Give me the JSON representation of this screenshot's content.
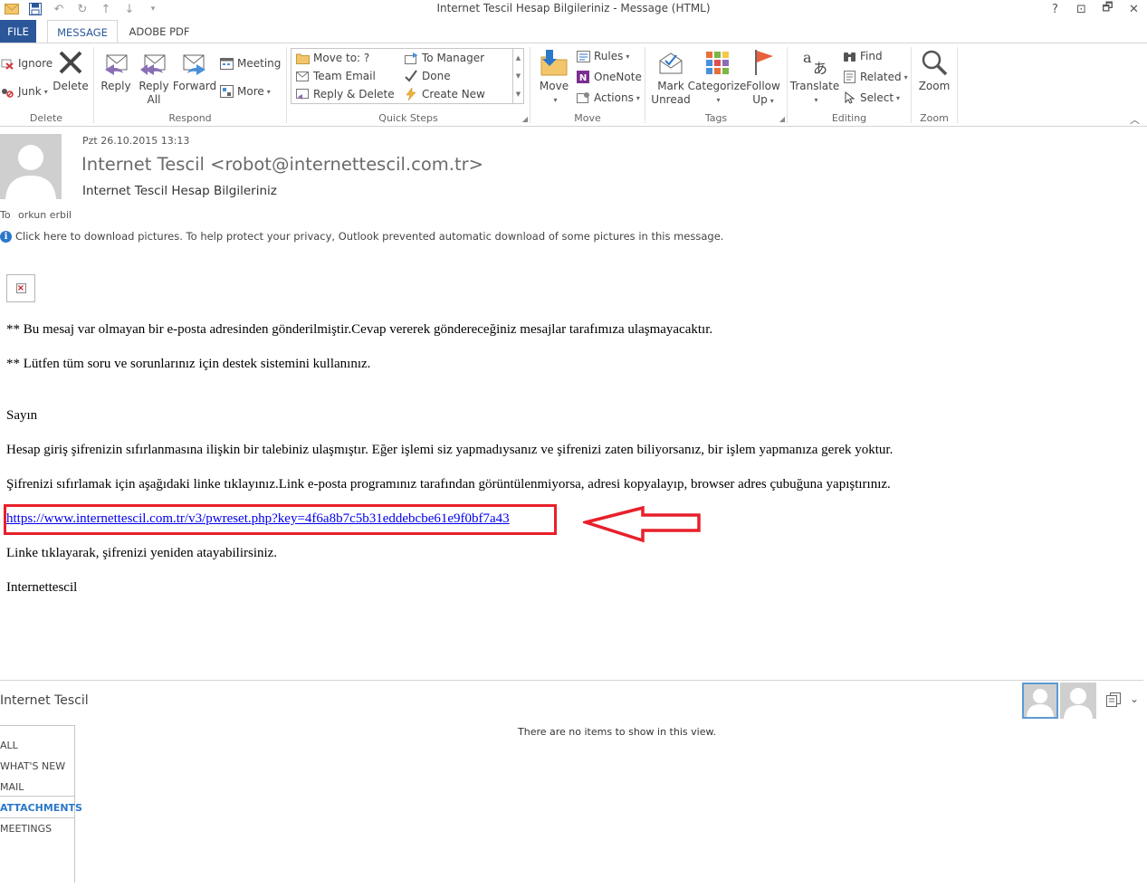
{
  "window": {
    "title": "Internet Tescil Hesap Bilgileriniz - Message (HTML)",
    "qat_icons": [
      "mail-icon",
      "save-icon",
      "undo-icon",
      "redo-icon",
      "up-icon",
      "down-icon",
      "customize-icon"
    ],
    "buttons": [
      "?",
      "⊡",
      "🗗",
      "✕"
    ]
  },
  "tabs": {
    "file": "FILE",
    "message": "MESSAGE",
    "adobe": "ADOBE PDF"
  },
  "ribbon": {
    "delete_group": {
      "label": "Delete",
      "ignore": "Ignore",
      "junk": "Junk",
      "delete": "Delete"
    },
    "respond_group": {
      "label": "Respond",
      "reply": "Reply",
      "reply_all_1": "Reply",
      "reply_all_2": "All",
      "forward": "Forward",
      "meeting": "Meeting",
      "more": "More"
    },
    "quick_steps": {
      "label": "Quick Steps",
      "move_to": "Move to: ?",
      "team_email": "Team Email",
      "reply_delete": "Reply & Delete",
      "to_manager": "To Manager",
      "done": "Done",
      "create_new": "Create New"
    },
    "move_group": {
      "label": "Move",
      "move": "Move",
      "rules": "Rules",
      "onenote": "OneNote",
      "actions": "Actions"
    },
    "tags_group": {
      "label": "Tags",
      "mark_unread_1": "Mark",
      "mark_unread_2": "Unread",
      "categorize": "Categorize",
      "follow_up_1": "Follow",
      "follow_up_2": "Up"
    },
    "editing_group": {
      "label": "Editing",
      "translate": "Translate",
      "find": "Find",
      "related": "Related",
      "select": "Select"
    },
    "zoom_group": {
      "label": "Zoom",
      "zoom": "Zoom"
    }
  },
  "message": {
    "date": "Pzt 26.10.2015 13:13",
    "sender": "Internet Tescil <robot@internettescil.com.tr>",
    "subject": "Internet Tescil Hesap Bilgileriniz",
    "to_label": "To",
    "to_name": "orkun erbil",
    "info_bar": "Click here to download pictures. To help protect your privacy, Outlook prevented automatic download of some pictures in this message."
  },
  "body": {
    "line1": "** Bu mesaj var olmayan bir e-posta adresinden gönderilmiştir.Cevap vererek göndereceğiniz mesajlar tarafımıza ulaşmayacaktır.",
    "line2": "** Lütfen tüm soru ve sorunlarınız için destek sistemini kullanınız.",
    "greeting": "Sayın",
    "para1": "Hesap giriş şifrenizin sıfırlanmasına ilişkin bir talebiniz ulaşmıştır. Eğer işlemi siz yapmadıysanız ve şifrenizi zaten biliyorsanız, bir işlem yapmanıza gerek yoktur.",
    "para2": "Şifrenizi sıfırlamak için aşağıdaki linke tıklayınız.Link e-posta programınız tarafından görüntülenmiyorsa, adresi kopyalayıp, browser adres çubuğuna yapıştırınız.",
    "link": "https://www.internettescil.com.tr/v3/pwreset.php?key=4f6a8b7c5b31eddebcbe61e9f0bf7a43",
    "para3": "Linke tıklayarak, şifrenizi yeniden atayabilirsiniz.",
    "signature": "Internettescil"
  },
  "annotation": {
    "box_color": "#e8202a"
  },
  "people_pane": {
    "name": "Internet Tescil",
    "nav": [
      "ALL",
      "WHAT'S NEW",
      "MAIL",
      "ATTACHMENTS",
      "MEETINGS"
    ],
    "active_nav": "ATTACHMENTS",
    "empty": "There are no items to show in this view."
  },
  "colors": {
    "accent": "#2b579a",
    "link": "#0000ee",
    "annotation": "#e8202a"
  }
}
